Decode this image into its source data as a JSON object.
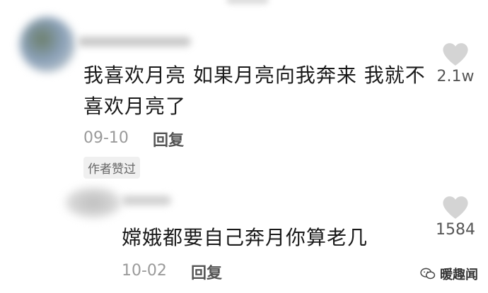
{
  "comments": [
    {
      "text_line1": "我喜欢月亮 如果月亮向我奔来 我就不",
      "text_line2": "喜欢月亮了",
      "date": "09-10",
      "reply_label": "回复",
      "badge": "作者赞过",
      "likes": "2.1w"
    },
    {
      "text_line1": "嫦娥都要自己奔月你算老几",
      "date": "10-02",
      "reply_label": "回复",
      "likes": "1584"
    }
  ],
  "watermark": {
    "label": "暖趣闻",
    "icon": "wechat-icon"
  },
  "colors": {
    "like_icon": "#d4d4d4",
    "date": "#9a9a9a",
    "badge_bg": "#f0f0f0"
  }
}
